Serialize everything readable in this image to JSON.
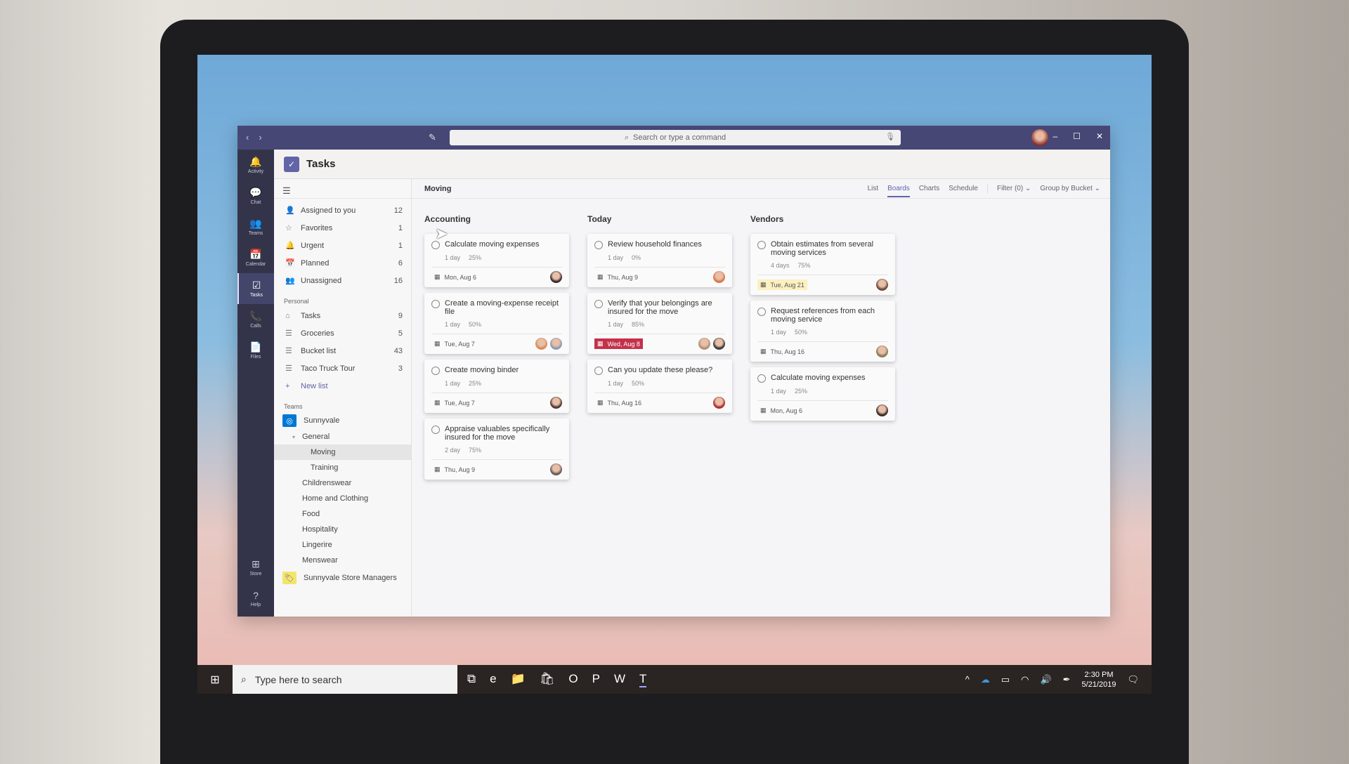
{
  "titlebar": {
    "search_placeholder": "Search or type a command"
  },
  "rail": [
    {
      "label": "Activity",
      "icon": "🔔"
    },
    {
      "label": "Chat",
      "icon": "💬"
    },
    {
      "label": "Teams",
      "icon": "👥"
    },
    {
      "label": "Calendar",
      "icon": "📅"
    },
    {
      "label": "Tasks",
      "icon": "☑",
      "active": true
    },
    {
      "label": "Calls",
      "icon": "📞"
    },
    {
      "label": "Files",
      "icon": "📄"
    }
  ],
  "rail_bottom": [
    {
      "label": "Store",
      "icon": "⊞"
    },
    {
      "label": "Help",
      "icon": "?"
    }
  ],
  "app": {
    "title": "Tasks"
  },
  "smart_lists": [
    {
      "label": "Assigned to you",
      "count": "12",
      "icon": "👤"
    },
    {
      "label": "Favorites",
      "count": "1",
      "icon": "☆"
    },
    {
      "label": "Urgent",
      "count": "1",
      "icon": "🔔"
    },
    {
      "label": "Planned",
      "count": "6",
      "icon": "📅"
    },
    {
      "label": "Unassigned",
      "count": "16",
      "icon": "👥"
    }
  ],
  "personal": {
    "heading": "Personal",
    "lists": [
      {
        "label": "Tasks",
        "count": "9",
        "icon": "⌂"
      },
      {
        "label": "Groceries",
        "count": "5",
        "icon": "☰"
      },
      {
        "label": "Bucket list",
        "count": "43",
        "icon": "☰"
      },
      {
        "label": "Taco Truck Tour",
        "count": "3",
        "icon": "☰"
      }
    ],
    "new_list": "New list"
  },
  "teams": {
    "heading": "Teams",
    "team": "Sunnyvale",
    "general": "General",
    "plans": [
      "Moving",
      "Training"
    ],
    "channels": [
      "Childrenswear",
      "Home and Clothing",
      "Food",
      "Hospitality",
      "Lingerire",
      "Menswear"
    ],
    "team2": "Sunnyvale Store Managers"
  },
  "board": {
    "title": "Moving",
    "tabs": [
      "List",
      "Boards",
      "Charts",
      "Schedule"
    ],
    "active_tab": "Boards",
    "filter": "Filter (0) ⌄",
    "group": "Group by Bucket ⌄",
    "columns": [
      {
        "title": "Accounting",
        "cards": [
          {
            "title": "Calculate moving expenses",
            "duration": "1 day",
            "progress": "25%",
            "due": "Mon, Aug 6",
            "avatars": [
              "#3a2a2a"
            ]
          },
          {
            "title": "Create a moving-expense receipt file",
            "duration": "1 day",
            "progress": "50%",
            "due": "Tue, Aug 7",
            "avatars": [
              "#d98a5a",
              "#8a9ab0"
            ]
          },
          {
            "title": "Create moving binder",
            "duration": "1 day",
            "progress": "25%",
            "due": "Tue, Aug 7",
            "avatars": [
              "#4a3a30"
            ]
          },
          {
            "title": "Appraise valuables specifically insured for the move",
            "duration": "2 day",
            "progress": "75%",
            "due": "Thu, Aug 9",
            "avatars": [
              "#6a5a5a"
            ]
          }
        ]
      },
      {
        "title": "Today",
        "cards": [
          {
            "title": "Review household finances",
            "duration": "1 day",
            "progress": "0%",
            "due": "Thu, Aug 9",
            "avatars": [
              "#d9784a"
            ]
          },
          {
            "title": "Verify that your belongings are insured for the move",
            "duration": "1 day",
            "progress": "85%",
            "due": "Wed, Aug 8",
            "due_state": "late",
            "avatars": [
              "#b09070",
              "#3a3a3a"
            ]
          },
          {
            "title": "Can you update these please?",
            "duration": "1 day",
            "progress": "50%",
            "due": "Thu, Aug 16",
            "avatars": [
              "#b02a2a"
            ]
          }
        ]
      },
      {
        "title": "Vendors",
        "cards": [
          {
            "title": "Obtain estimates from several moving services",
            "duration": "4 days",
            "progress": "75%",
            "due": "Tue, Aug 21",
            "due_state": "soon",
            "avatars": [
              "#6a4a3a"
            ]
          },
          {
            "title": "Request references from each moving service",
            "duration": "1 day",
            "progress": "50%",
            "due": "Thu, Aug 16",
            "avatars": [
              "#8a7a5a"
            ]
          },
          {
            "title": "Calculate moving expenses",
            "duration": "1 day",
            "progress": "25%",
            "due": "Mon, Aug 6",
            "avatars": [
              "#3a2a2a"
            ]
          }
        ]
      }
    ]
  },
  "taskbar": {
    "search_placeholder": "Type here to search",
    "apps": [
      {
        "name": "task-view",
        "icon": "⧉"
      },
      {
        "name": "edge",
        "icon": "e"
      },
      {
        "name": "file-explorer",
        "icon": "📁"
      },
      {
        "name": "store",
        "icon": "🛍"
      },
      {
        "name": "outlook",
        "icon": "O"
      },
      {
        "name": "powerpoint",
        "icon": "P"
      },
      {
        "name": "word",
        "icon": "W"
      },
      {
        "name": "teams",
        "icon": "T",
        "active": true
      }
    ],
    "time": "2:30 PM",
    "date": "5/21/2019"
  },
  "colors": {
    "accent": "#6264a7",
    "titlebar": "#464775",
    "rail": "#33344a",
    "late": "#c4314b",
    "soon": "#fbf0c0"
  }
}
